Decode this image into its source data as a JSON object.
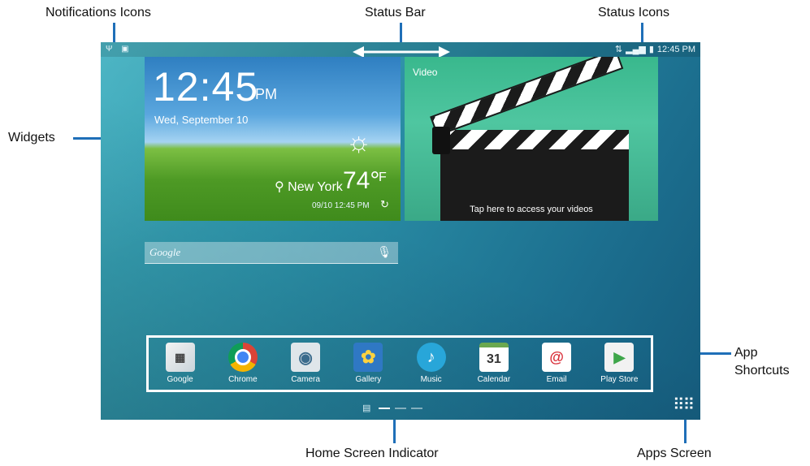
{
  "callouts": {
    "notifications_icons": "Notifications Icons",
    "status_bar": "Status Bar",
    "status_icons": "Status Icons",
    "widgets": "Widgets",
    "app_shortcuts_1": "App",
    "app_shortcuts_2": "Shortcuts",
    "home_screen_indicator": "Home Screen Indicator",
    "apps_screen": "Apps Screen"
  },
  "colors": {
    "callout_line": "#1f6fb8",
    "wallpaper": "#2a8ea6"
  },
  "status_bar": {
    "left_icons": [
      "usb-icon",
      "picture-icon"
    ],
    "left_icon_glyphs": "Ψ ▣",
    "time": "12:45 PM",
    "right_icons": [
      "wifi-icon",
      "signal-icon",
      "battery-icon"
    ]
  },
  "clock_widget": {
    "time": "12:45",
    "ampm": "PM",
    "date": "Wed, September 10",
    "city": "New York",
    "temperature": "74°",
    "unit": "F",
    "updated": "09/10 12:45 PM"
  },
  "video_widget": {
    "title": "Video",
    "caption": "Tap here to access your videos"
  },
  "search": {
    "label": "Google"
  },
  "apps": [
    {
      "label": "Google",
      "icon": "google-folder-icon"
    },
    {
      "label": "Chrome",
      "icon": "chrome-icon"
    },
    {
      "label": "Camera",
      "icon": "camera-icon"
    },
    {
      "label": "Gallery",
      "icon": "gallery-icon"
    },
    {
      "label": "Music",
      "icon": "music-icon"
    },
    {
      "label": "Calendar",
      "icon": "calendar-icon",
      "day": "31"
    },
    {
      "label": "Email",
      "icon": "email-icon"
    },
    {
      "label": "Play Store",
      "icon": "play-store-icon"
    }
  ]
}
